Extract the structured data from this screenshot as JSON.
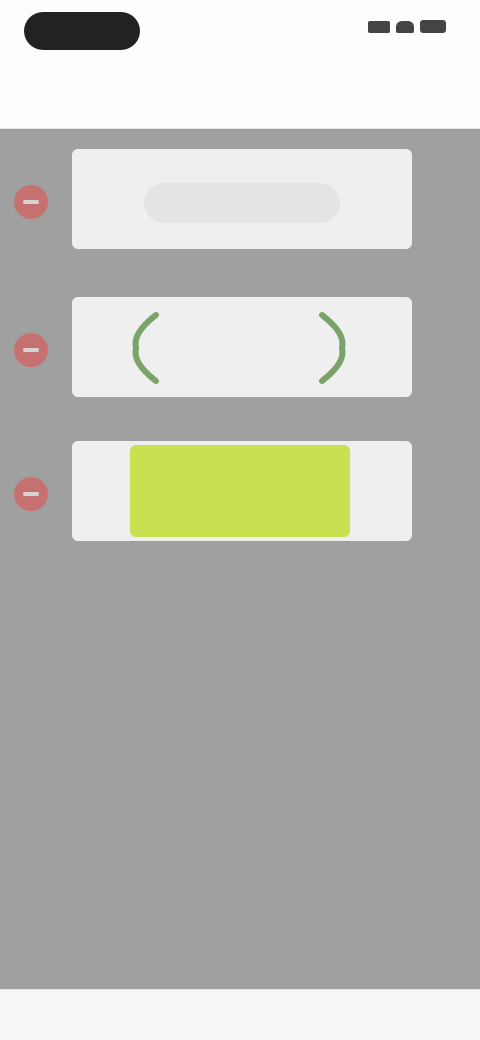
{
  "status_bar": {
    "time": "",
    "icons": [
      "signal-icon",
      "wifi-icon",
      "battery-icon"
    ]
  },
  "nav": {
    "title": "",
    "back_label": "",
    "action_label": ""
  },
  "rows": [
    {
      "type": "text",
      "text": ""
    },
    {
      "type": "brackets"
    },
    {
      "type": "color",
      "color": "#c9e050"
    }
  ],
  "colors": {
    "overlay": "#a0a0a0",
    "delete": "#e64a4a",
    "accent_green": "#7aa36a",
    "highlight": "#c9e050"
  }
}
